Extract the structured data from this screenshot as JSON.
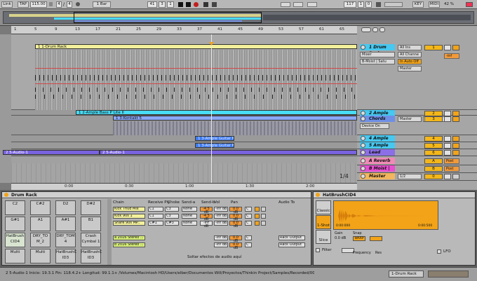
{
  "transport": {
    "link": "Link",
    "tap": "TAP",
    "tempo": "115.00",
    "sig_num": "4",
    "sig_sep": "/",
    "sig_den": "4",
    "quant": "1 Bar",
    "pos1": "41",
    "pos2": "3",
    "pos3": "1",
    "loop_start": "117",
    "loop_sep1": "1",
    "loop_sep2": "0",
    "key": "KEY",
    "midi": "MIDI",
    "cpu": "42 %"
  },
  "ruler": {
    "ticks": [
      "1",
      "5",
      "9",
      "13",
      "17",
      "21",
      "25",
      "29",
      "33",
      "37",
      "41",
      "45",
      "49",
      "53",
      "57",
      "61",
      "65"
    ],
    "time_ticks": [
      "0:00",
      "0:30",
      "1:00",
      "1:30",
      "2:00",
      "2:30"
    ]
  },
  "clips": {
    "drum_rack": "1 1-Drum Rack",
    "ample_bass": "1 2-Ample Bass P Lite II",
    "kontakt": "1 3-Kontakt 5",
    "guitar_a": "1 3-Ample Guitar M II",
    "guitar_b": "1 3-Ample Guitar M II",
    "audio1_a": "2 5-Audio-1",
    "audio1_b": "2 5-Audio-1",
    "page": "1/4"
  },
  "tracks": [
    {
      "name": "1 Drum Rack",
      "color": "#46c8f0",
      "input": "All Ins",
      "channel": "All Channe",
      "monitor": "In Auto Off",
      "out": "Master",
      "num": "1",
      "vol": "-inf"
    },
    {
      "name": "2 Ample Bas",
      "color": "#46c8f0",
      "input": "",
      "channel": "",
      "monitor": "",
      "out": "",
      "num": "2",
      "vol": ""
    },
    {
      "name": "Chords",
      "color": "#6f8fe6",
      "input": "All Ins",
      "channel": "",
      "monitor": "Off",
      "out": "Master",
      "num": "3",
      "vol": ""
    },
    {
      "name": "4 Ample Gui",
      "color": "#46c8f0",
      "input": "",
      "channel": "",
      "monitor": "",
      "out": "",
      "num": "4",
      "vol": ""
    },
    {
      "name": "5 Ample Gui",
      "color": "#46c8f0",
      "input": "",
      "channel": "",
      "monitor": "",
      "out": "",
      "num": "5",
      "vol": ""
    },
    {
      "name": "Lead",
      "color": "#8b6fe6",
      "input": "",
      "channel": "",
      "monitor": "",
      "out": "",
      "num": "6",
      "vol": ""
    },
    {
      "name": "A Reverb",
      "color": "#f08ab6",
      "input": "",
      "channel": "",
      "monitor": "",
      "out": "",
      "num": "A",
      "vol": "Post"
    },
    {
      "name": "B Moist | Sa",
      "color": "#e64fd0",
      "input": "",
      "channel": "",
      "monitor": "",
      "out": "",
      "num": "B",
      "vol": "Post"
    },
    {
      "name": "Master",
      "color": "#f2b65e",
      "input": "",
      "channel": "",
      "monitor": "",
      "out": "1/2",
      "num": "0",
      "vol": ""
    }
  ],
  "mixer_first": {
    "mixer": "Mixer",
    "preset": "B-Moist | Satu",
    "device_on": "Device On"
  },
  "drum_rack": {
    "title": "Drum Rack",
    "pads": [
      [
        "C2",
        "C#2",
        "D2",
        "D#2"
      ],
      [
        "G#1",
        "A1",
        "A#1",
        "B1"
      ],
      [
        "HatBrush CID4",
        "DRY_TO M_2",
        "DRY_TOM 4",
        "Crash Cymbal 1"
      ],
      [
        "Multi",
        "Multi",
        "HatBrushC ID3",
        "HatBrushC ID3"
      ]
    ],
    "chain_headers": [
      "Chain",
      "Receive Ply",
      "Choke",
      "Send-a",
      "Send-b",
      "Vol",
      "Pan",
      "",
      "Audio To"
    ],
    "chains": [
      {
        "name": "Kick Thud Mix",
        "recv": "C1",
        "ply": "C3",
        "choke": "None",
        "send_a": "-4.5 dB",
        "send_b": "-inf dB",
        "vol": "0.0 dB",
        "pan": "C"
      },
      {
        "name": "Kick 90s 1",
        "recv": "C1",
        "ply": "C3",
        "choke": "None",
        "send_a": "-4.5 dB",
        "send_b": "-inf dB",
        "vol": "0.0 dB",
        "pan": "C"
      },
      {
        "name": "Snare 90s MP..",
        "recv": "C#1",
        "ply": "C#3",
        "choke": "None",
        "send_a": "-inf dB",
        "send_b": "-inf dB",
        "vol": "0.0 dB",
        "pan": "C"
      }
    ],
    "returns": [
      {
        "name": "a 2016 Stereo ...",
        "send_b": "-inf dB",
        "vol": "0.0 dB",
        "pan": "C",
        "out": "Rack Output"
      },
      {
        "name": "b 2016 Stereo ...",
        "send_b": "-inf dB",
        "vol": "0.0 dB",
        "pan": "C",
        "out": "Rack Output"
      }
    ],
    "drop_hint": "Soltar efectos de audio aquí"
  },
  "sampler": {
    "title": "HatBrushCID4",
    "modes": [
      "Classic",
      "1-Shot",
      "Slice"
    ],
    "time_a": "0:00:000",
    "time_b": "0:00:500",
    "gain": "Gain",
    "gain_val": "0.0 dB",
    "snap": "Snap",
    "warp": "WARP",
    "filter": "Filter",
    "lfo": "LFO",
    "frequency": "Frequency",
    "res": "Res"
  },
  "status": {
    "text": "2 5-Audio-1  Inicio: 19.3.1  Fin: 118.4.2+  Longitud: 99.1.1+  /Volumes/Macintosh HD/Users/elber/Documentos Will/Proyectos/Thinkin Project/Samples/Recorded/0002 ...",
    "device": "1-Drum Rack"
  },
  "colors": {
    "drum_clip": "#f3f09c",
    "bass_clip": "#48dcf5",
    "kontakt_clip": "#8aa6f5",
    "guitar_clip": "#3e7cf0",
    "audio_clip": "#7a63e0",
    "accent_orange": "#f2a318"
  }
}
